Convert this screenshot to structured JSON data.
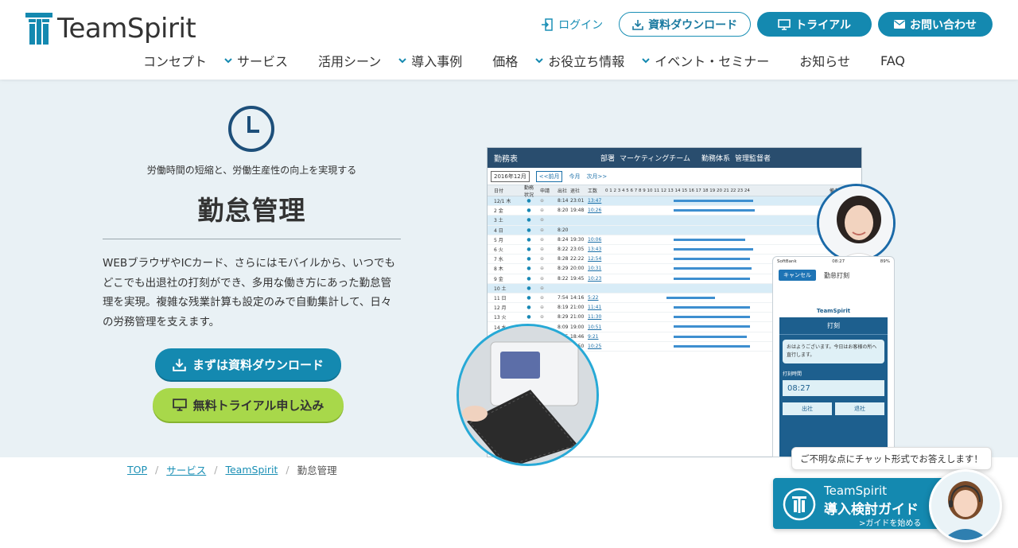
{
  "header": {
    "logo_text": "TeamSpirit",
    "login": "ログイン",
    "download": "資料ダウンロード",
    "trial": "トライアル",
    "contact": "お問い合わせ",
    "nav": [
      {
        "label": "コンセプト",
        "dropdown": false
      },
      {
        "label": "サービス",
        "dropdown": true
      },
      {
        "label": "活用シーン",
        "dropdown": false
      },
      {
        "label": "導入事例",
        "dropdown": true
      },
      {
        "label": "価格",
        "dropdown": false
      },
      {
        "label": "お役立ち情報",
        "dropdown": true
      },
      {
        "label": "イベント・セミナー",
        "dropdown": true
      },
      {
        "label": "お知らせ",
        "dropdown": false
      },
      {
        "label": "FAQ",
        "dropdown": false
      }
    ]
  },
  "hero": {
    "subtitle": "労働時間の短縮と、労働生産性の向上を実現する",
    "title": "勤怠管理",
    "description": "WEBブラウザやICカード、さらにはモバイルから、いつでもどこでも出退社の打刻ができ、多用な働き方にあった勤怠管理を実現。複雑な残業計算も設定のみで自動集計して、日々の労務管理を支えます。",
    "cta_download": "まずは資料ダウンロード",
    "cta_trial": "無料トライアル申し込み"
  },
  "mockup": {
    "title": "勤務表",
    "dept_label": "部署",
    "dept": "マーケティングチーム",
    "type_label": "勤務体系",
    "type": "管理監督者",
    "month": "2016年12月",
    "prev": "<<前月",
    "this_month": "今月",
    "next": "次月>>",
    "header_cols": [
      "日付",
      "勤務状況",
      "申請",
      "出社",
      "退社",
      "工数"
    ],
    "hours": "0 1 2 3 4 5 6 7 8 9 10 11 12 13 14 15 16 17 18 19 20 21 22 23 24",
    "remarks": "備考",
    "rows": [
      {
        "d": "12/1 木",
        "in": "8:14",
        "out": "23:01",
        "w": "13:47",
        "s": 9.0,
        "e": 19.4,
        "t": "blue"
      },
      {
        "d": "2 金",
        "in": "8:20",
        "out": "19:48",
        "w": "10:26",
        "s": 9.0,
        "e": 19.6,
        "t": ""
      },
      {
        "d": "3 土",
        "in": "",
        "out": "",
        "w": "",
        "s": 0,
        "e": 0,
        "t": "blue"
      },
      {
        "d": "4 日",
        "in": "8:20",
        "out": "",
        "w": "",
        "s": 0,
        "e": 0,
        "t": "blue"
      },
      {
        "d": "5 月",
        "in": "8:24",
        "out": "19:30",
        "w": "10:06",
        "s": 9.0,
        "e": 18.4,
        "t": ""
      },
      {
        "d": "6 火",
        "in": "8:22",
        "out": "23:05",
        "w": "13:43",
        "s": 9.0,
        "e": 19.4,
        "t": ""
      },
      {
        "d": "7 水",
        "in": "8:28",
        "out": "22:22",
        "w": "12:54",
        "s": 9.0,
        "e": 19.0,
        "t": ""
      },
      {
        "d": "8 木",
        "in": "8:29",
        "out": "20:00",
        "w": "10:31",
        "s": 9.0,
        "e": 19.2,
        "t": ""
      },
      {
        "d": "9 金",
        "in": "8:22",
        "out": "19:45",
        "w": "10:23",
        "s": 9.0,
        "e": 19.0,
        "t": ""
      },
      {
        "d": "10 土",
        "in": "",
        "out": "",
        "w": "",
        "s": 0,
        "e": 0,
        "t": "blue"
      },
      {
        "d": "11 日",
        "in": "7:54",
        "out": "14:16",
        "w": "5:22",
        "s": 8.0,
        "e": 14.4,
        "t": ""
      },
      {
        "d": "12 月",
        "in": "8:19",
        "out": "21:00",
        "w": "11:41",
        "s": 9.0,
        "e": 19.0,
        "t": ""
      },
      {
        "d": "13 火",
        "in": "8:29",
        "out": "21:00",
        "w": "11:30",
        "s": 9.0,
        "e": 19.0,
        "t": ""
      },
      {
        "d": "14 水",
        "in": "8:09",
        "out": "19:00",
        "w": "10:51",
        "s": 9.0,
        "e": 19.0,
        "t": ""
      },
      {
        "d": "15 木",
        "in": "8:25",
        "out": "18:46",
        "w": "9:21",
        "s": 9.0,
        "e": 18.6,
        "t": ""
      },
      {
        "d": "",
        "in": "",
        "out": "19:50",
        "w": "10:25",
        "s": 9.0,
        "e": 19.0,
        "t": ""
      }
    ],
    "phone": {
      "carrier": "SoftBank",
      "clock": "08:27",
      "battery": "89%",
      "cancel": "キャンセル",
      "title": "勤怠打刻",
      "logo": "TeamSpirit",
      "section": "打刻",
      "message": "おはようございます。今日はお客様の所へ直行します。",
      "time_label": "打刻時間",
      "time": "08:27",
      "in_btn": "出社",
      "out_btn": "退社"
    }
  },
  "breadcrumb": {
    "items": [
      "TOP",
      "サービス",
      "TeamSpirit",
      "勤怠管理"
    ]
  },
  "chat": {
    "bubble": "ご不明な点にチャット形式でお答えします！",
    "line1": "TeamSpirit",
    "line2": "導入検討ガイド",
    "link": ">ガイドを始める"
  },
  "colors": {
    "primary": "#1489b0",
    "accent_green": "#a8d84a",
    "hero_bg": "#e9f1f5",
    "navy": "#294d6e"
  }
}
